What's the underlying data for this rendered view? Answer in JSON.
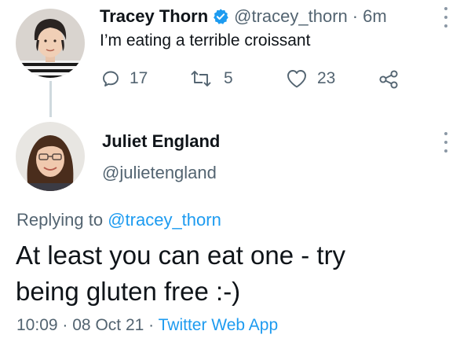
{
  "colors": {
    "accent": "#1d9bf0",
    "muted": "#536471",
    "verified": "#1d9bf0"
  },
  "tweet": {
    "author": {
      "name": "Tracey Thorn",
      "handle": "@tracey_thorn",
      "verified": true
    },
    "separator": "·",
    "time": "6m",
    "text": "I’m eating a terrible croissant",
    "actions": {
      "replies": {
        "icon": "reply-icon",
        "count": "17"
      },
      "retweets": {
        "icon": "retweet-icon",
        "count": "5"
      },
      "likes": {
        "icon": "heart-icon",
        "count": "23"
      },
      "share": {
        "icon": "share-icon"
      }
    }
  },
  "reply": {
    "author": {
      "name": "Juliet England",
      "handle": "@julietengland"
    },
    "replying_to": {
      "prefix": "Replying to",
      "handle": "@tracey_thorn"
    },
    "text_line1": "At least you can eat one - try",
    "text_line2": "being gluten free :-)",
    "meta": {
      "time": "10:09",
      "separator": "·",
      "date": "08 Oct 21",
      "separator2": "·",
      "source": "Twitter Web App"
    }
  }
}
